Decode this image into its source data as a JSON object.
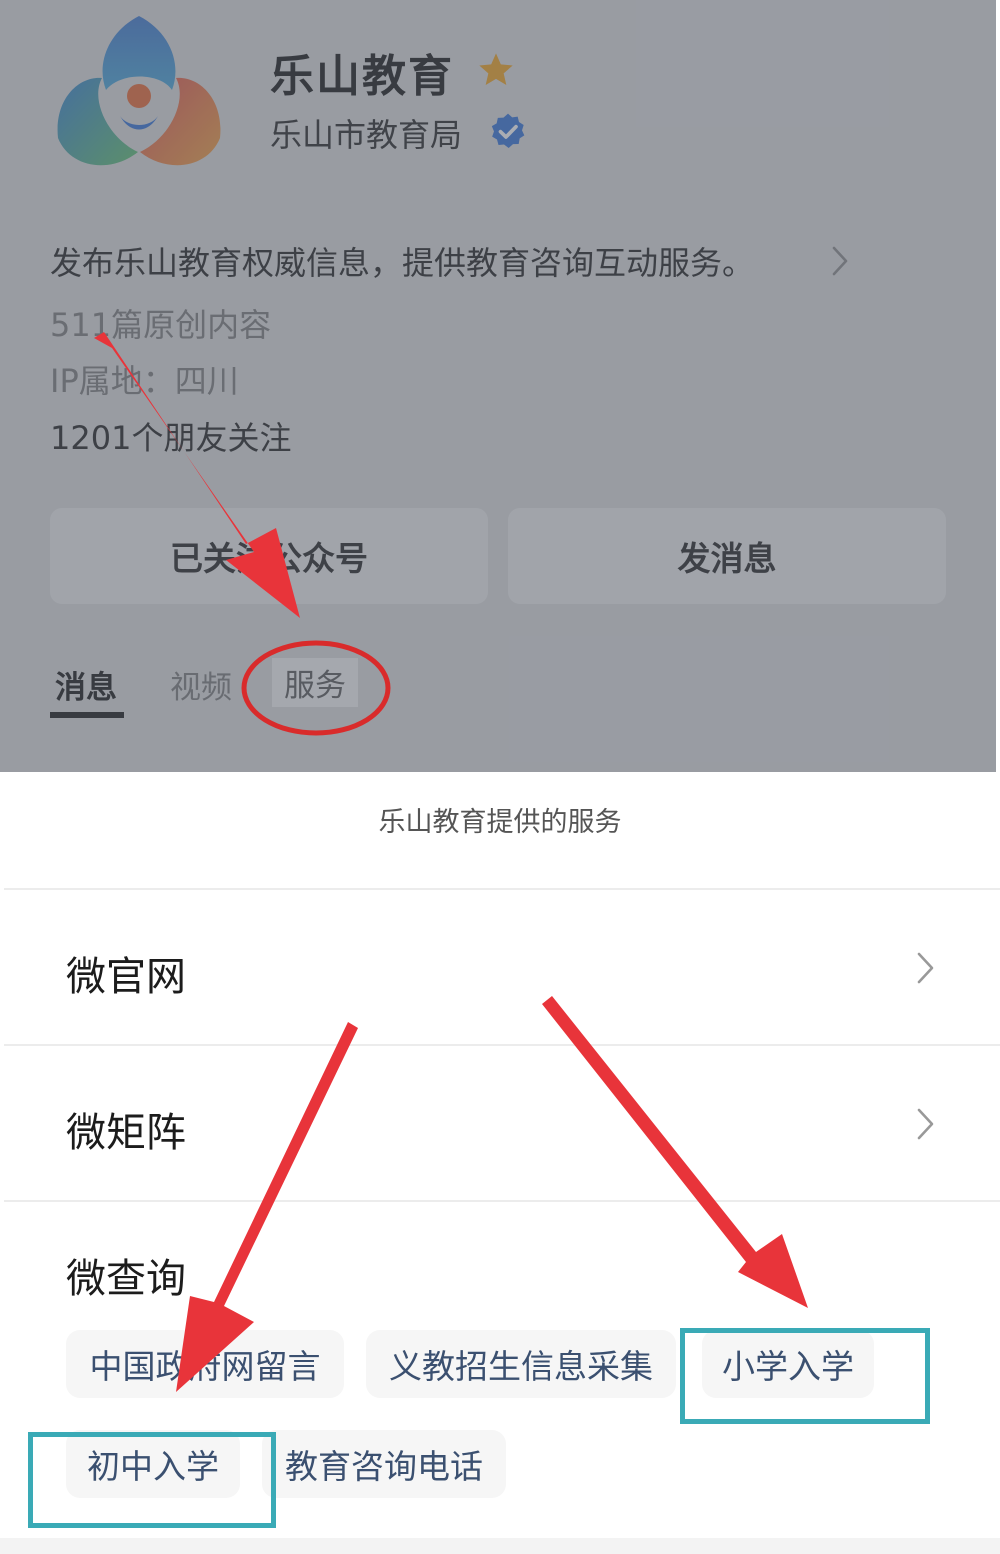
{
  "profile": {
    "account_name": "乐山教育",
    "org_name": "乐山市教育局",
    "description": "发布乐山教育权威信息，提供教育咨询互动服务。",
    "original_count": "511篇原创内容",
    "ip_location": "IP属地：四川",
    "friends_follow": "1201个朋友关注",
    "followed_button": "已关注公众号",
    "message_button": "发消息",
    "tabs": {
      "messages": "消息",
      "videos": "视频",
      "services": "服务"
    },
    "icons": [
      "logo-icon",
      "star-icon",
      "verified-icon",
      "chevron-right-icon"
    ]
  },
  "services": {
    "title": "乐山教育提供的服务",
    "rows": [
      {
        "label": "微官网"
      },
      {
        "label": "微矩阵"
      },
      {
        "label": "微查询"
      }
    ],
    "chips": {
      "gov_message": "中国政府网留言",
      "enrollment_info": "义教招生信息采集",
      "primary_school": "小学入学",
      "middle_school": "初中入学",
      "edu_hotline": "教育咨询电话"
    }
  },
  "colors": {
    "annotation_arrow": "#e8343a",
    "highlight_box": "#3aaab6",
    "annotation_circle": "#d92b2b",
    "star": "#f0a11a",
    "verified": "#2e6fd6"
  }
}
